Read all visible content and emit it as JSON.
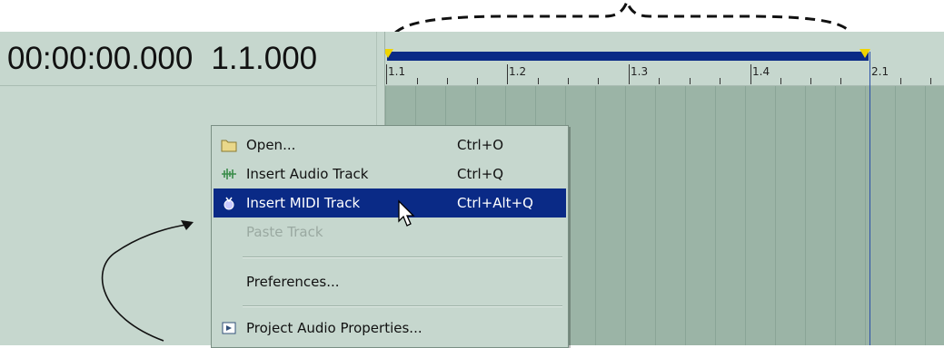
{
  "timecode": {
    "time": "00:00:00.000",
    "measure": "1.1.000"
  },
  "ruler": {
    "labels": [
      "1.1",
      "1.2",
      "1.3",
      "1.4",
      "2.1"
    ]
  },
  "menu": {
    "items": [
      {
        "label": "Open...",
        "shortcut": "Ctrl+O",
        "icon": "folder-icon",
        "state": "normal"
      },
      {
        "label": "Insert Audio Track",
        "shortcut": "Ctrl+Q",
        "icon": "audio-track-icon",
        "state": "normal"
      },
      {
        "label": "Insert MIDI Track",
        "shortcut": "Ctrl+Alt+Q",
        "icon": "midi-track-icon",
        "state": "selected"
      },
      {
        "label": "Paste Track",
        "shortcut": "",
        "icon": "",
        "state": "disabled"
      },
      {
        "label": "Preferences...",
        "shortcut": "",
        "icon": "",
        "state": "normal"
      },
      {
        "label": "Project Audio Properties...",
        "shortcut": "",
        "icon": "properties-icon",
        "state": "normal"
      }
    ]
  },
  "colors": {
    "panel": "#c6d7ce",
    "timeline": "#9bb4a6",
    "selection": "#0a2a86",
    "marker": "#f0d400"
  }
}
